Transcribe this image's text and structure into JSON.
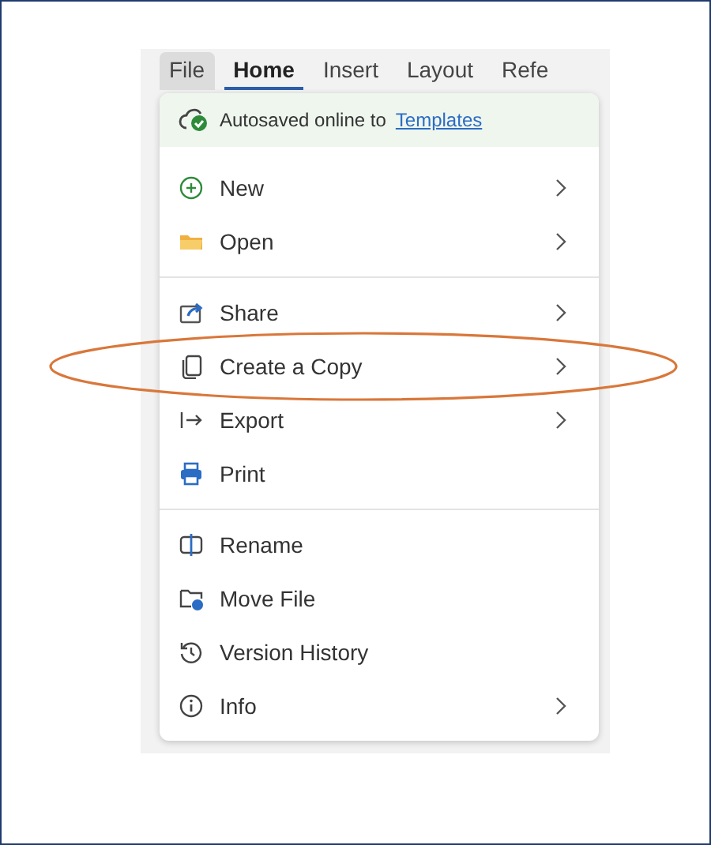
{
  "tabs": [
    {
      "label": "File",
      "selected": false,
      "open": true
    },
    {
      "label": "Home",
      "selected": true,
      "open": false
    },
    {
      "label": "Insert",
      "selected": false,
      "open": false
    },
    {
      "label": "Layout",
      "selected": false,
      "open": false
    },
    {
      "label": "Refe",
      "selected": false,
      "open": false
    }
  ],
  "menu": {
    "autosave": {
      "text": "Autosaved online to",
      "link": "Templates"
    },
    "sections": [
      [
        {
          "label": "New",
          "submenu": true,
          "circled": false
        },
        {
          "label": "Open",
          "submenu": true,
          "circled": false
        }
      ],
      [
        {
          "label": "Share",
          "submenu": true,
          "circled": false
        },
        {
          "label": "Create a Copy",
          "submenu": true,
          "circled": true
        },
        {
          "label": "Export",
          "submenu": true,
          "circled": false
        },
        {
          "label": "Print",
          "submenu": false,
          "circled": false
        }
      ],
      [
        {
          "label": "Rename",
          "submenu": false,
          "circled": false
        },
        {
          "label": "Move File",
          "submenu": false,
          "circled": false
        },
        {
          "label": "Version History",
          "submenu": false,
          "circled": false
        },
        {
          "label": "Info",
          "submenu": true,
          "circled": false
        }
      ]
    ]
  }
}
